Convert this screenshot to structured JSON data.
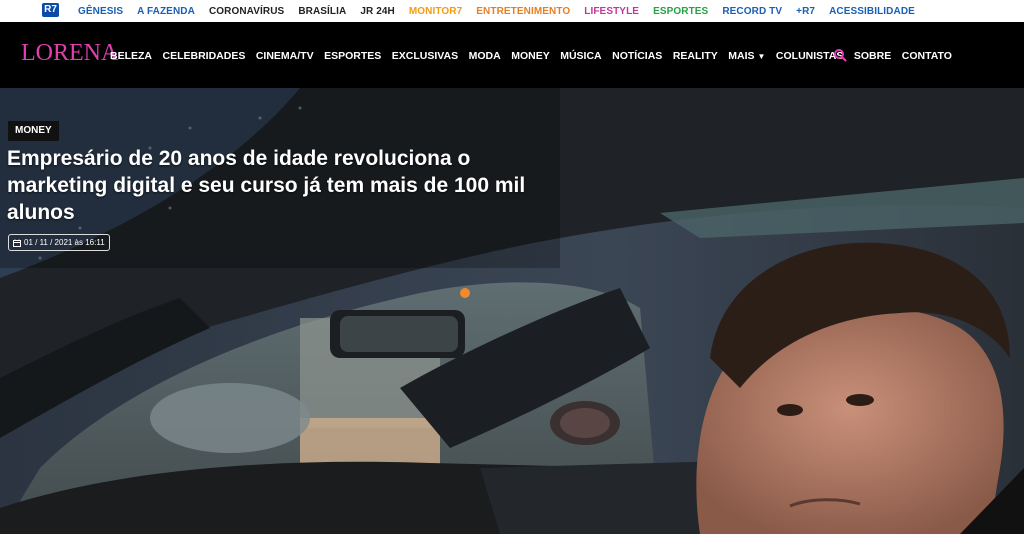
{
  "topbar": {
    "logo_text": "R7",
    "links": [
      {
        "label": "GÊNESIS",
        "color": "#1a5fb4"
      },
      {
        "label": "A FAZENDA",
        "color": "#1a5fb4"
      },
      {
        "label": "CORONAVÍRUS",
        "color": "#222222"
      },
      {
        "label": "BRASÍLIA",
        "color": "#222222"
      },
      {
        "label": "JR 24H",
        "color": "#222222"
      },
      {
        "label": "MONITOR7",
        "color": "#f39c12"
      },
      {
        "label": "ENTRETENIMENTO",
        "color": "#e67e22"
      },
      {
        "label": "LIFESTYLE",
        "color": "#c0399a"
      },
      {
        "label": "ESPORTES",
        "color": "#27a046"
      },
      {
        "label": "RECORD TV",
        "color": "#1a5fb4"
      },
      {
        "label": "+R7",
        "color": "#1a5fb4"
      },
      {
        "label": "ACESSIBILIDADE",
        "color": "#1a5fb4"
      }
    ]
  },
  "nav": {
    "logo": "LORENA",
    "logo_color": "#e03fb0",
    "items": [
      "BELEZA",
      "CELEBRIDADES",
      "CINEMA/TV",
      "ESPORTES",
      "EXCLUSIVAS",
      "MODA",
      "MONEY",
      "MÚSICA",
      "NOTÍCIAS",
      "REALITY",
      "MAIS",
      "COLUNISTAS",
      "SOBRE",
      "CONTATO"
    ],
    "search_icon": "search-icon",
    "search_color": "#e03fb0"
  },
  "hero": {
    "category": "MONEY",
    "headline": "Empresário de 20 anos de idade revoluciona o marketing digital e seu curso já tem mais de 100 mil alunos",
    "date": "01 / 11 / 2021 às 16:11",
    "date_icon": "calendar-icon"
  }
}
